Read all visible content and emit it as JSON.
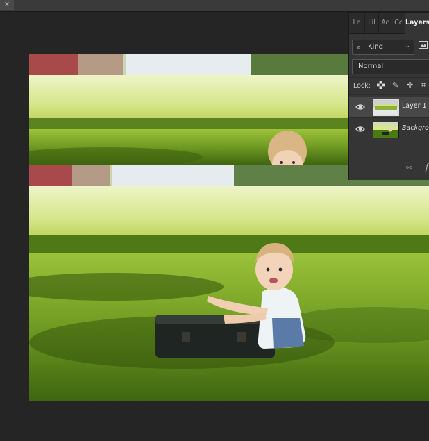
{
  "window": {
    "close_glyph": "×"
  },
  "panel_tabs": [
    {
      "label": "Le",
      "active": false
    },
    {
      "label": "Lil",
      "active": false
    },
    {
      "label": "Ac",
      "active": false
    },
    {
      "label": "Cc",
      "active": false
    },
    {
      "label": "Layers",
      "active": true
    }
  ],
  "filter": {
    "kind_label": "Kind",
    "search_icon": "search-icon",
    "image_filter_icon": "image-filter-icon"
  },
  "blend_mode": "Normal",
  "lock": {
    "label": "Lock:",
    "icons": [
      "lock-transparent-pixels-icon",
      "lock-image-pixels-icon",
      "lock-position-icon",
      "lock-artboard-icon"
    ]
  },
  "layers": [
    {
      "name": "Layer 1",
      "visible": true,
      "selected": true,
      "italic": false
    },
    {
      "name": "Backgrou",
      "visible": true,
      "selected": false,
      "italic": true
    }
  ],
  "footer": {
    "link_icon": "link-layers-icon",
    "fx_label": "f"
  },
  "colors": {
    "grass": "#5c8a1f",
    "grass_dark": "#2f4a0c",
    "panel": "#353535",
    "canvas_bg": "#252525"
  }
}
